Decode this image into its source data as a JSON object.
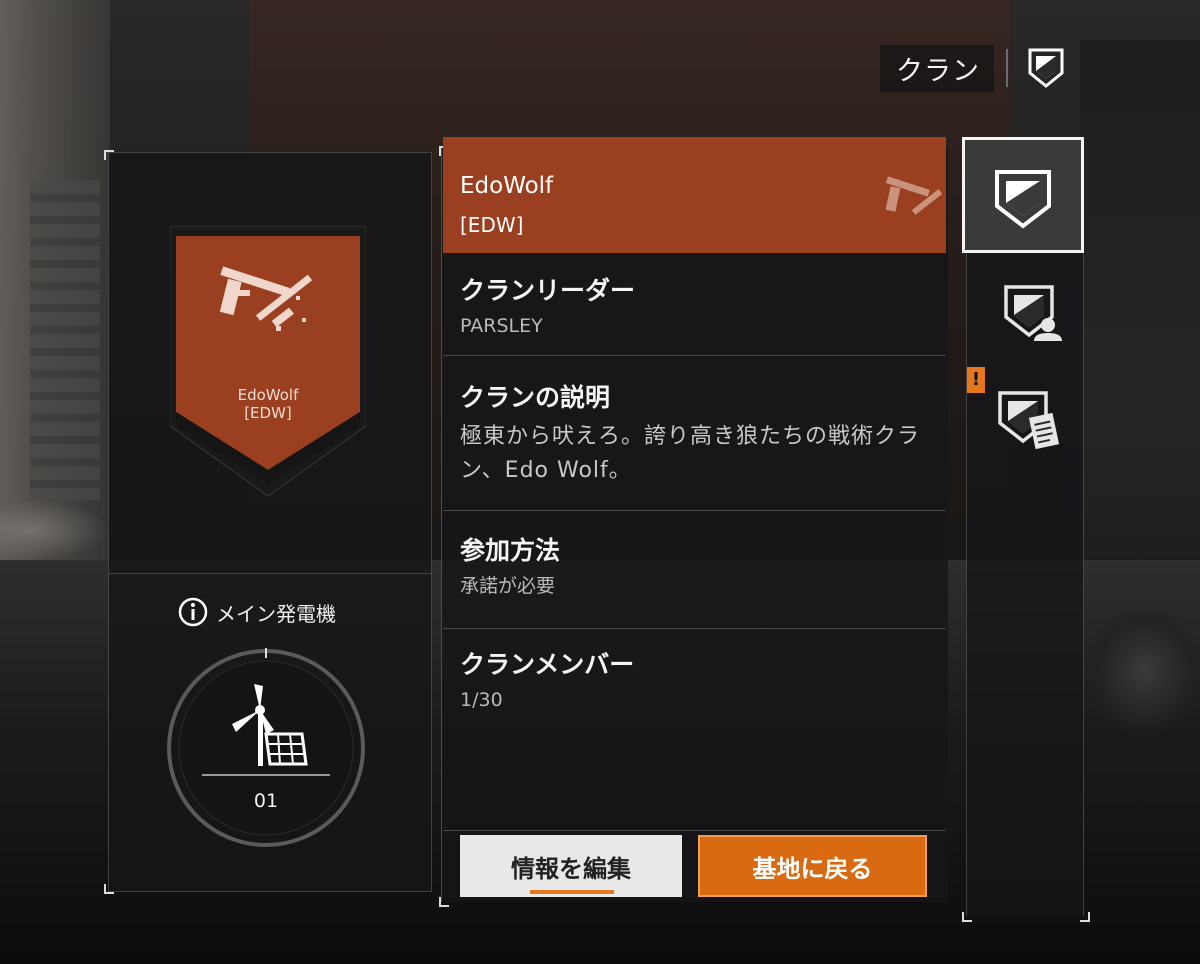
{
  "header": {
    "title": "クラン",
    "icon": "clan-shield-icon"
  },
  "emblem": {
    "name": "EdoWolf",
    "tag": "[EDW]",
    "color": "#9a3f1f",
    "icon": "crossed-weapons-icon"
  },
  "generator": {
    "title": "メイン発電機",
    "level": "01",
    "icon": "wind-turbine-solar-icon"
  },
  "clan": {
    "name": "EdoWolf",
    "tag": "[EDW]"
  },
  "fields": [
    {
      "title": "クランリーダー",
      "value": "PARSLEY"
    },
    {
      "title": "クランの説明",
      "value": "極東から吠えろ。誇り高き狼たちの戦術クラン、Edo Wolf。"
    },
    {
      "title": "参加方法",
      "value": "承諾が必要"
    },
    {
      "title": "クランメンバー",
      "value": "1/30"
    }
  ],
  "buttons": {
    "edit": "情報を編集",
    "return_base": "基地に戻る"
  },
  "tabs": [
    {
      "icon": "clan-shield-icon",
      "active": true
    },
    {
      "icon": "clan-member-icon",
      "active": false
    },
    {
      "icon": "clan-log-icon",
      "active": false,
      "alert": "!"
    }
  ],
  "colors": {
    "accent": "#d96a12",
    "clan_color": "#9a3f1f"
  }
}
